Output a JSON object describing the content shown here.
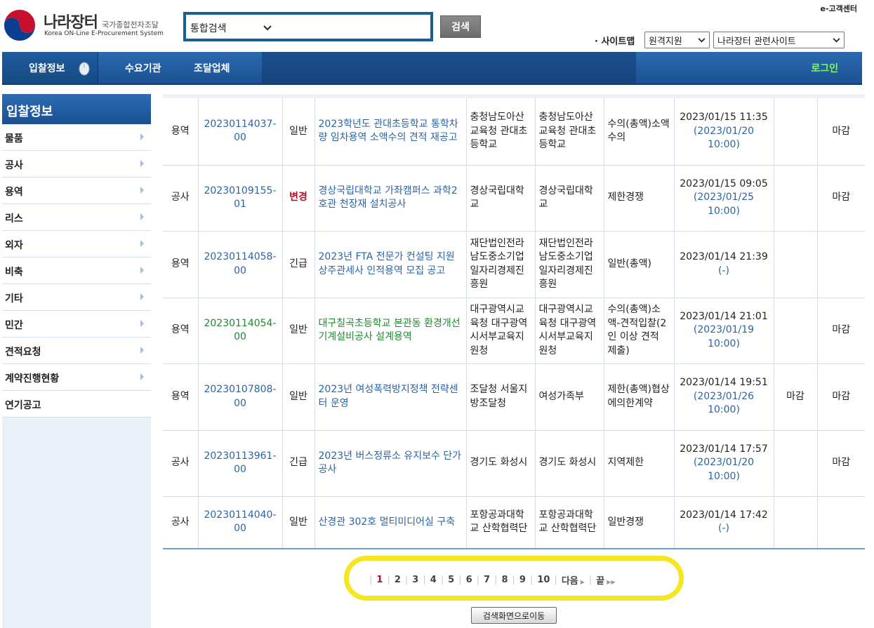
{
  "header": {
    "logo_title": "나라장터",
    "logo_subtitle": "국가종합전자조달",
    "logo_english": "Korea ON-Line E-Procurement System",
    "search_scope": "통합검색",
    "search_button": "검색",
    "customer_center": "e-고객센터",
    "sitemap_label": "· 사이트맵",
    "remote_support": "원격지원",
    "related_sites": "나라장터 관련사이트"
  },
  "nav": {
    "items": [
      "입찰정보",
      "수요기관",
      "조달업체"
    ],
    "login": "로그인"
  },
  "sidebar": {
    "title": "입찰정보",
    "items": [
      "물품",
      "공사",
      "용역",
      "리스",
      "외자",
      "비축",
      "기타",
      "민간",
      "견적요청",
      "계약진행현황",
      "연기공고"
    ]
  },
  "rows": [
    {
      "category": "용역",
      "number": "20230114037-00",
      "type": "일반",
      "title": "2023학년도 관대초등학교 통학차량 임차용역 소액수의 견적 재공고",
      "agency": "충청남도아산교육청 관대초등학교",
      "demand": "충청남도아산교육청 관대초등학교",
      "method": "수의(총액)소액수의",
      "posted": "2023/01/15 11:35",
      "deadline": "(2023/01/20 10:00)",
      "col9": "",
      "status": "마감"
    },
    {
      "category": "공사",
      "number": "20230109155-01",
      "type": "변경",
      "title": "경상국립대학교 가좌캠퍼스 과학2호관 천장재 설치공사",
      "agency": "경상국립대학교",
      "demand": "경상국립대학교",
      "method": "제한경쟁",
      "posted": "2023/01/15 09:05",
      "deadline": "(2023/01/25 10:00)",
      "col9": "",
      "status": "마감"
    },
    {
      "category": "용역",
      "number": "20230114058-00",
      "type": "긴급",
      "title": "2023년 FTA 전문가 컨설팅 지원 상주관세사 인적용역 모집 공고",
      "agency": "재단법인전라남도중소기업일자리경제진흥원",
      "demand": "재단법인전라남도중소기업일자리경제진흥원",
      "method": "일반(총액)",
      "posted": "2023/01/14 21:39",
      "deadline": "(-)",
      "col9": "",
      "status": ""
    },
    {
      "category": "용역",
      "number": "20230114054-00",
      "type": "일반",
      "title": "대구칠곡초등학교 본관동 환경개선 기계설비공사 설계용역",
      "agency": "대구광역시교육청 대구광역시서부교육지원청",
      "demand": "대구광역시교육청 대구광역시서부교육지원청",
      "method": "수의(총액)소액-견적입찰(2인 이상 견적 제출)",
      "posted": "2023/01/14 21:01",
      "deadline": "(2023/01/19 10:00)",
      "col9": "",
      "status": "마감"
    },
    {
      "category": "용역",
      "number": "20230107808-00",
      "type": "일반",
      "title": "2023년 여성폭력방지정책 전략센터 운영",
      "agency": "조달청 서울지방조달청",
      "demand": "여성가족부",
      "method": "제한(총액)협상에의한계약",
      "posted": "2023/01/14 19:51",
      "deadline": "(2023/01/26 10:00)",
      "col9": "마감",
      "status": "마감"
    },
    {
      "category": "공사",
      "number": "20230113961-00",
      "type": "긴급",
      "title": "2023년 버스정류소 유지보수 단가공사",
      "agency": "경기도 화성시",
      "demand": "경기도 화성시",
      "method": "지역제한",
      "posted": "2023/01/14 17:57",
      "deadline": "(2023/01/20 10:00)",
      "col9": "",
      "status": "마감"
    },
    {
      "category": "공사",
      "number": "20230114040-00",
      "type": "일반",
      "title": "산경관 302호 멀티미디어실 구축",
      "agency": "포항공과대학교 산학협력단",
      "demand": "포항공과대학교 산학협력단",
      "method": "일반경쟁",
      "posted": "2023/01/14 17:42",
      "deadline": "(-)",
      "col9": "",
      "status": ""
    }
  ],
  "pagination": {
    "pages": [
      "1",
      "2",
      "3",
      "4",
      "5",
      "6",
      "7",
      "8",
      "9",
      "10"
    ],
    "current": "1",
    "next": "다음",
    "last": "끝"
  },
  "back_button": "검색화면으로이동",
  "colors": {
    "nav_blue": "#1d5093",
    "link_blue": "#2a64a6",
    "link_green": "#1d8a2d",
    "change_red": "#a8132b",
    "highlight_yellow": "#f5e620",
    "login_green": "#7cfc5a"
  }
}
